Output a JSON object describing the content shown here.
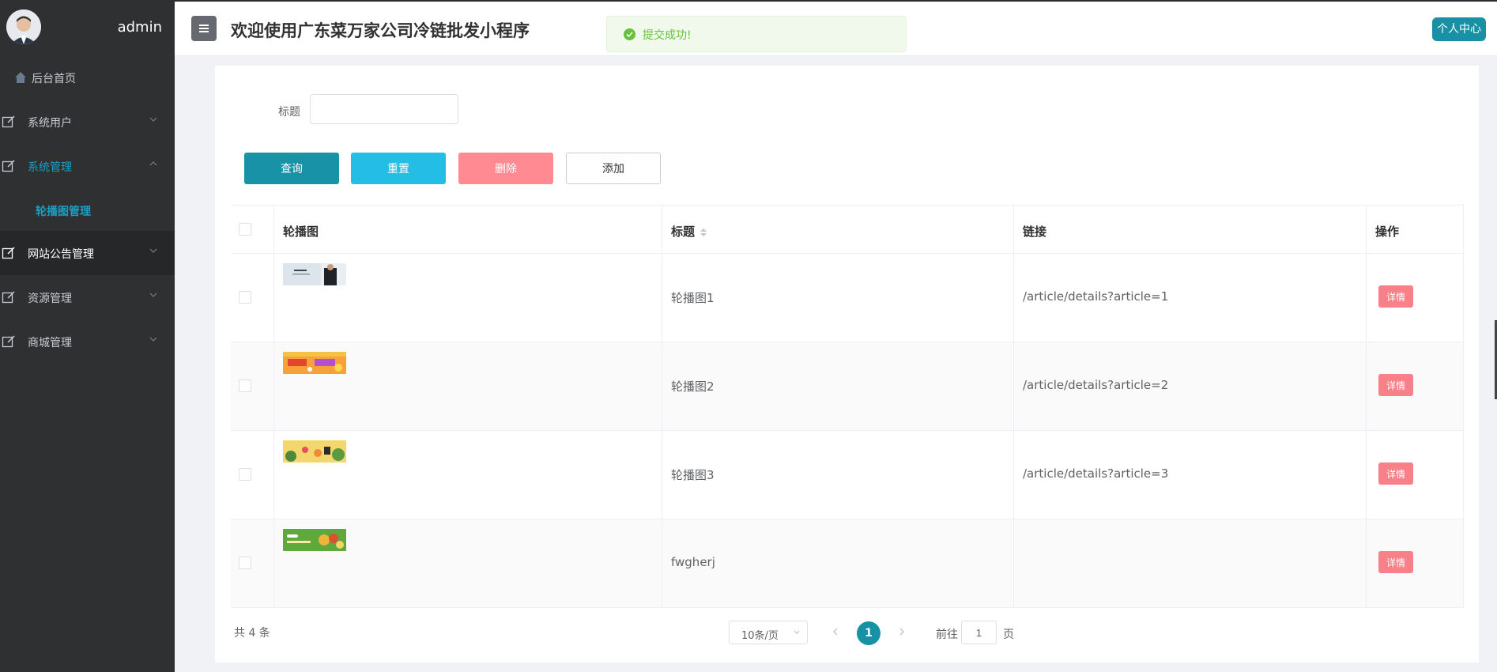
{
  "sidebar": {
    "admin_name": "admin",
    "items": [
      {
        "label": "后台首页",
        "icon": "home-icon"
      },
      {
        "label": "系统用户",
        "icon": "edit-icon"
      },
      {
        "label": "系统管理",
        "icon": "edit-icon"
      },
      {
        "label": "轮播图管理",
        "icon": ""
      },
      {
        "label": "网站公告管理",
        "icon": "edit-icon"
      },
      {
        "label": "资源管理",
        "icon": "edit-icon"
      },
      {
        "label": "商城管理",
        "icon": "edit-icon"
      }
    ]
  },
  "header": {
    "title": "欢迎使用广东菜万家公司冷链批发小程序",
    "toast": "提交成功!",
    "user_center": "个人中心"
  },
  "search": {
    "label": "标题",
    "value": "",
    "placeholder": ""
  },
  "buttons": {
    "query": "查询",
    "reset": "重置",
    "delete": "删除",
    "add": "添加"
  },
  "table": {
    "headers": [
      "轮播图",
      "标题",
      "链接",
      "操作"
    ],
    "rows": [
      {
        "title": "轮播图1",
        "link": "/article/details?article=1",
        "action": "详情"
      },
      {
        "title": "轮播图2",
        "link": "/article/details?article=2",
        "action": "详情"
      },
      {
        "title": "轮播图3",
        "link": "/article/details?article=3",
        "action": "详情"
      },
      {
        "title": "fwgherj",
        "link": "",
        "action": "详情"
      }
    ]
  },
  "pagination": {
    "total": "共 4 条",
    "page_size": "10条/页",
    "current_page": "1",
    "goto_label": "前往",
    "goto_value": "1",
    "goto_suffix": "页"
  },
  "colors": {
    "sidebar_bg": "#2f3032",
    "accent": "#1791a3",
    "reset": "#23bde6",
    "danger": "#ff8a92",
    "success": "#67c23a"
  }
}
